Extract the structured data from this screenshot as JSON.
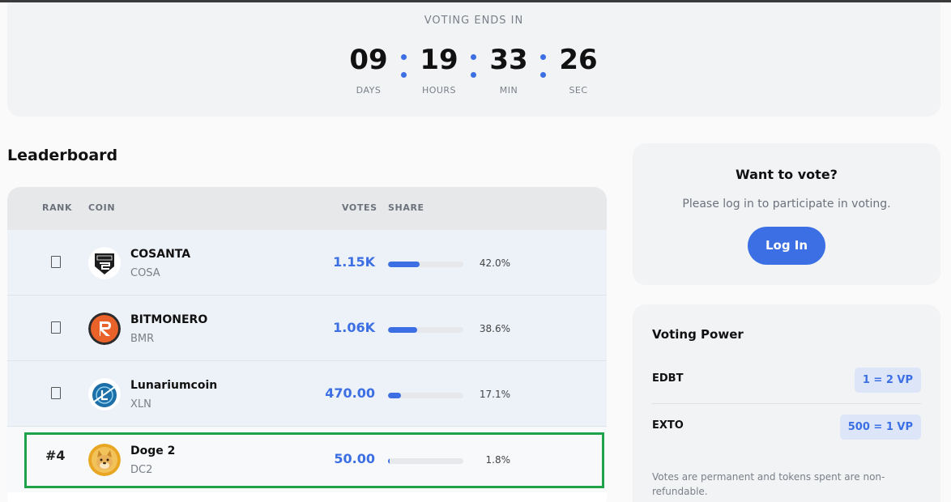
{
  "countdown": {
    "title": "VOTING ENDS IN",
    "days": "09",
    "days_label": "DAYS",
    "hours": "19",
    "hours_label": "HOURS",
    "min": "33",
    "min_label": "MIN",
    "sec": "26",
    "sec_label": "SEC"
  },
  "leaderboard": {
    "title": "Leaderboard",
    "headers": {
      "rank": "RANK",
      "coin": "COIN",
      "votes": "VOTES",
      "share": "SHARE"
    },
    "rows": [
      {
        "rank": "",
        "rank_icon": "medal-icon",
        "name": "COSANTA",
        "symbol": "COSA",
        "votes": "1.15K",
        "share_pct": "42.0%",
        "share": 0.42
      },
      {
        "rank": "",
        "rank_icon": "medal-icon",
        "name": "BITMONERO",
        "symbol": "BMR",
        "votes": "1.06K",
        "share_pct": "38.6%",
        "share": 0.386
      },
      {
        "rank": "",
        "rank_icon": "medal-icon",
        "name": "Lunariumcoin",
        "symbol": "XLN",
        "votes": "470.00",
        "share_pct": "17.1%",
        "share": 0.171
      },
      {
        "rank": "#4",
        "name": "Doge 2",
        "symbol": "DC2",
        "votes": "50.00",
        "share_pct": "1.8%",
        "share": 0.018
      }
    ]
  },
  "vote_card": {
    "title": "Want to vote?",
    "subtitle": "Please log in to participate in voting.",
    "login_label": "Log In"
  },
  "voting_power": {
    "title": "Voting Power",
    "items": [
      {
        "token": "EDBT",
        "rate": "1 = 2 VP"
      },
      {
        "token": "EXTO",
        "rate": "500 = 1 VP"
      }
    ],
    "note": "Votes are permanent and tokens spent are non-refundable."
  },
  "colors": {
    "accent": "#3b6fe3",
    "highlight": "#1fa34a"
  }
}
